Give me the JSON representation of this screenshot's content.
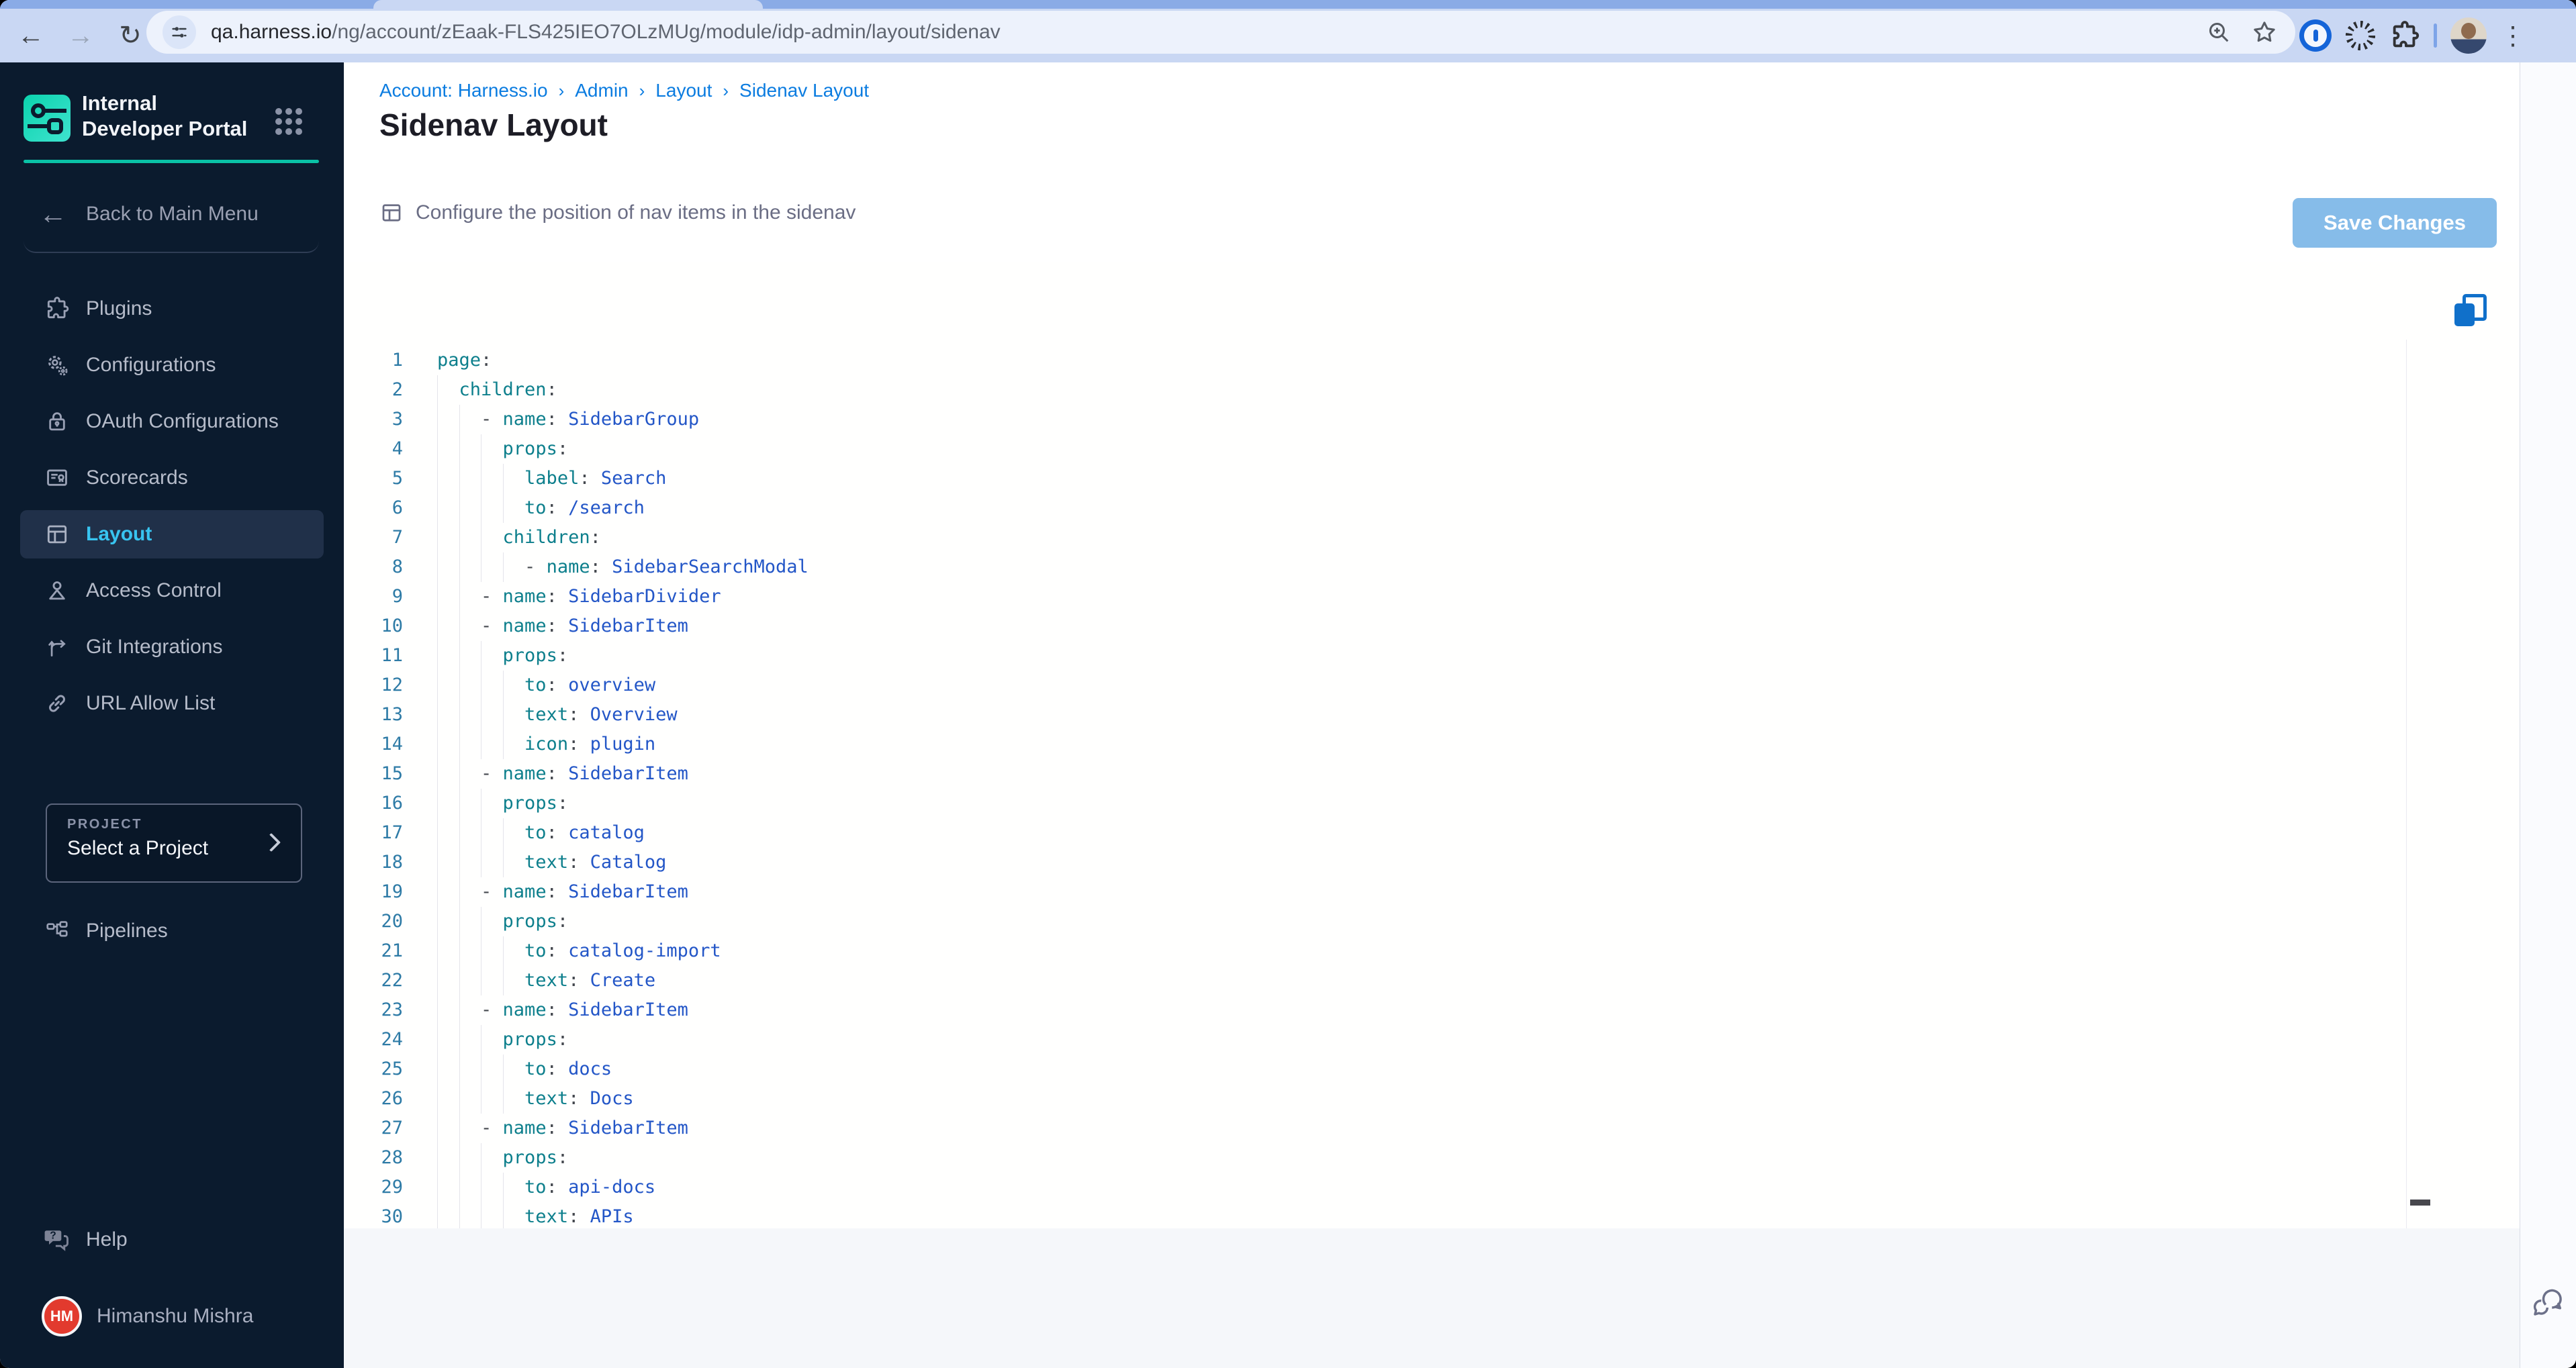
{
  "browser": {
    "url_host": "qa.harness.io",
    "url_path": "/ng/account/zEaak-FLS425IEO7OLzMUg/module/idp-admin/layout/sidenav"
  },
  "sidebar": {
    "product_title": "Internal Developer Portal",
    "back_label": "Back to Main Menu",
    "items": [
      {
        "label": "Plugins",
        "icon": "puzzle-icon",
        "active": false
      },
      {
        "label": "Configurations",
        "icon": "gears-icon",
        "active": false
      },
      {
        "label": "OAuth Configurations",
        "icon": "lock-icon",
        "active": false
      },
      {
        "label": "Scorecards",
        "icon": "scorecard-icon",
        "active": false
      },
      {
        "label": "Layout",
        "icon": "layout-icon",
        "active": true
      },
      {
        "label": "Access Control",
        "icon": "person-icon",
        "active": false
      },
      {
        "label": "Git Integrations",
        "icon": "git-branch-icon",
        "active": false
      },
      {
        "label": "URL Allow List",
        "icon": "link-icon",
        "active": false
      }
    ],
    "project": {
      "label": "PROJECT",
      "value": "Select a Project"
    },
    "pipelines_label": "Pipelines",
    "help_label": "Help",
    "user": {
      "initials": "HM",
      "name": "Himanshu Mishra"
    }
  },
  "header": {
    "breadcrumb": [
      "Account: Harness.io",
      "Admin",
      "Layout",
      "Sidenav Layout"
    ],
    "title": "Sidenav Layout"
  },
  "toolbar": {
    "description": "Configure the position of nav items in the sidenav",
    "save_label": "Save Changes"
  },
  "editor": {
    "lines": [
      {
        "n": 1,
        "indent": 0,
        "dash": false,
        "key": "page",
        "value": ""
      },
      {
        "n": 2,
        "indent": 2,
        "dash": false,
        "key": "children",
        "value": ""
      },
      {
        "n": 3,
        "indent": 4,
        "dash": true,
        "key": "name",
        "value": "SidebarGroup"
      },
      {
        "n": 4,
        "indent": 6,
        "dash": false,
        "key": "props",
        "value": ""
      },
      {
        "n": 5,
        "indent": 8,
        "dash": false,
        "key": "label",
        "value": "Search"
      },
      {
        "n": 6,
        "indent": 8,
        "dash": false,
        "key": "to",
        "value": "/search"
      },
      {
        "n": 7,
        "indent": 6,
        "dash": false,
        "key": "children",
        "value": ""
      },
      {
        "n": 8,
        "indent": 8,
        "dash": true,
        "key": "name",
        "value": "SidebarSearchModal"
      },
      {
        "n": 9,
        "indent": 4,
        "dash": true,
        "key": "name",
        "value": "SidebarDivider"
      },
      {
        "n": 10,
        "indent": 4,
        "dash": true,
        "key": "name",
        "value": "SidebarItem"
      },
      {
        "n": 11,
        "indent": 6,
        "dash": false,
        "key": "props",
        "value": ""
      },
      {
        "n": 12,
        "indent": 8,
        "dash": false,
        "key": "to",
        "value": "overview"
      },
      {
        "n": 13,
        "indent": 8,
        "dash": false,
        "key": "text",
        "value": "Overview"
      },
      {
        "n": 14,
        "indent": 8,
        "dash": false,
        "key": "icon",
        "value": "plugin"
      },
      {
        "n": 15,
        "indent": 4,
        "dash": true,
        "key": "name",
        "value": "SidebarItem"
      },
      {
        "n": 16,
        "indent": 6,
        "dash": false,
        "key": "props",
        "value": ""
      },
      {
        "n": 17,
        "indent": 8,
        "dash": false,
        "key": "to",
        "value": "catalog"
      },
      {
        "n": 18,
        "indent": 8,
        "dash": false,
        "key": "text",
        "value": "Catalog"
      },
      {
        "n": 19,
        "indent": 4,
        "dash": true,
        "key": "name",
        "value": "SidebarItem"
      },
      {
        "n": 20,
        "indent": 6,
        "dash": false,
        "key": "props",
        "value": ""
      },
      {
        "n": 21,
        "indent": 8,
        "dash": false,
        "key": "to",
        "value": "catalog-import"
      },
      {
        "n": 22,
        "indent": 8,
        "dash": false,
        "key": "text",
        "value": "Create"
      },
      {
        "n": 23,
        "indent": 4,
        "dash": true,
        "key": "name",
        "value": "SidebarItem"
      },
      {
        "n": 24,
        "indent": 6,
        "dash": false,
        "key": "props",
        "value": ""
      },
      {
        "n": 25,
        "indent": 8,
        "dash": false,
        "key": "to",
        "value": "docs"
      },
      {
        "n": 26,
        "indent": 8,
        "dash": false,
        "key": "text",
        "value": "Docs"
      },
      {
        "n": 27,
        "indent": 4,
        "dash": true,
        "key": "name",
        "value": "SidebarItem"
      },
      {
        "n": 28,
        "indent": 6,
        "dash": false,
        "key": "props",
        "value": ""
      },
      {
        "n": 29,
        "indent": 8,
        "dash": false,
        "key": "to",
        "value": "api-docs"
      },
      {
        "n": 30,
        "indent": 8,
        "dash": false,
        "key": "text",
        "value": "APIs"
      }
    ]
  },
  "colors": {
    "sidebar_bg": "#0b1b2e",
    "accent_teal": "#0ac2a6",
    "active_cyan": "#38c4f0",
    "breadcrumb_blue": "#0b7ce0",
    "save_button_blue": "#86bce9",
    "copy_icon_blue": "#1070ca",
    "yaml_key_teal": "#0d7f8c",
    "yaml_value_blue": "#2356c7",
    "line_number_blue": "#2e7ba6",
    "avatar_red": "#e23a2e"
  }
}
